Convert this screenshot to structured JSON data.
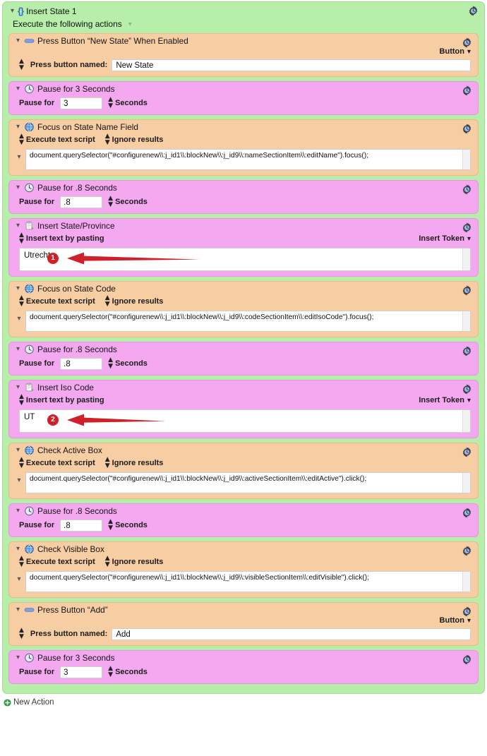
{
  "macro": {
    "title": "Insert State 1",
    "icon": "braces-icon",
    "subhead": "Execute the following actions",
    "gear": "gear-icon"
  },
  "footer": {
    "new_action_label": "New Action",
    "icon": "plus-circle-icon"
  },
  "labels": {
    "press_button_named": "Press button named:",
    "pause_for": "Pause for",
    "seconds_unit": "Seconds",
    "execute_text_script": "Execute text script",
    "ignore_results": "Ignore results",
    "insert_text_by_pasting": "Insert text by pasting",
    "insert_token": "Insert Token",
    "button_dropdown": "Button"
  },
  "colors": {
    "macro_green": "#b6eeaa",
    "action_orange": "#f7cda4",
    "action_pink": "#f4a8f0",
    "annotation_red": "#d0212b",
    "accent_blue": "#2f6fd0",
    "footer_green": "#2e9e3f"
  },
  "actions": [
    {
      "kind": "press-button",
      "tint": "orange",
      "icon": "button-pill-icon",
      "title": "Press Button “New State” When Enabled",
      "dropdown": "Button",
      "field_label": "Press button named:",
      "field_value": "New State"
    },
    {
      "kind": "pause",
      "tint": "pink",
      "icon": "clock-icon",
      "title": "Pause for 3 Seconds",
      "pause_label": "Pause for",
      "pause_value": "3",
      "unit": "Seconds"
    },
    {
      "kind": "script",
      "tint": "orange",
      "icon": "globe-icon",
      "title": "Focus on State Name Field",
      "opt1": "Execute text script",
      "opt2": "Ignore results",
      "script": "document.querySelector(\"#configurenew\\\\:j_id1\\\\:blockNew\\\\:j_id9\\\\:nameSectionItem\\\\:editName\").focus();"
    },
    {
      "kind": "pause",
      "tint": "pink",
      "icon": "clock-icon",
      "title": "Pause for .8 Seconds",
      "pause_label": "Pause for",
      "pause_value": ".8",
      "unit": "Seconds"
    },
    {
      "kind": "paste",
      "tint": "pink",
      "icon": "clipboard-icon",
      "title": "Insert State/Province",
      "opt1": "Insert text by pasting",
      "right_label": "Insert Token",
      "value": "Utrecht",
      "annotation": "1"
    },
    {
      "kind": "script",
      "tint": "orange",
      "icon": "globe-icon",
      "title": "Focus on State Code",
      "opt1": "Execute text script",
      "opt2": "Ignore results",
      "script": "document.querySelector(\"#configurenew\\\\:j_id1\\\\:blockNew\\\\:j_id9\\\\:codeSectionItem\\\\:editIsoCode\").focus();"
    },
    {
      "kind": "pause",
      "tint": "pink",
      "icon": "clock-icon",
      "title": "Pause for .8 Seconds",
      "pause_label": "Pause for",
      "pause_value": ".8",
      "unit": "Seconds"
    },
    {
      "kind": "paste",
      "tint": "pink",
      "icon": "clipboard-icon",
      "title": "Insert Iso Code",
      "opt1": "Insert text by pasting",
      "right_label": "Insert Token",
      "value": "UT",
      "annotation": "2"
    },
    {
      "kind": "script",
      "tint": "orange",
      "icon": "globe-icon",
      "title": "Check Active Box",
      "opt1": "Execute text script",
      "opt2": "Ignore results",
      "script": "document.querySelector(\"#configurenew\\\\:j_id1\\\\:blockNew\\\\:j_id9\\\\:activeSectionItem\\\\:editActive\").click();"
    },
    {
      "kind": "pause",
      "tint": "pink",
      "icon": "clock-icon",
      "title": "Pause for .8 Seconds",
      "pause_label": "Pause for",
      "pause_value": ".8",
      "unit": "Seconds"
    },
    {
      "kind": "script",
      "tint": "orange",
      "icon": "globe-icon",
      "title": "Check Visible Box",
      "opt1": "Execute text script",
      "opt2": "Ignore results",
      "script": "document.querySelector(\"#configurenew\\\\:j_id1\\\\:blockNew\\\\:j_id9\\\\:visibleSectionItem\\\\:editVisible\").click();"
    },
    {
      "kind": "press-button",
      "tint": "orange",
      "icon": "button-pill-icon",
      "title": "Press Button “Add”",
      "dropdown": "Button",
      "field_label": "Press button named:",
      "field_value": "Add"
    },
    {
      "kind": "pause",
      "tint": "pink",
      "icon": "clock-icon",
      "title": "Pause for 3 Seconds",
      "pause_label": "Pause for",
      "pause_value": "3",
      "unit": "Seconds"
    }
  ]
}
